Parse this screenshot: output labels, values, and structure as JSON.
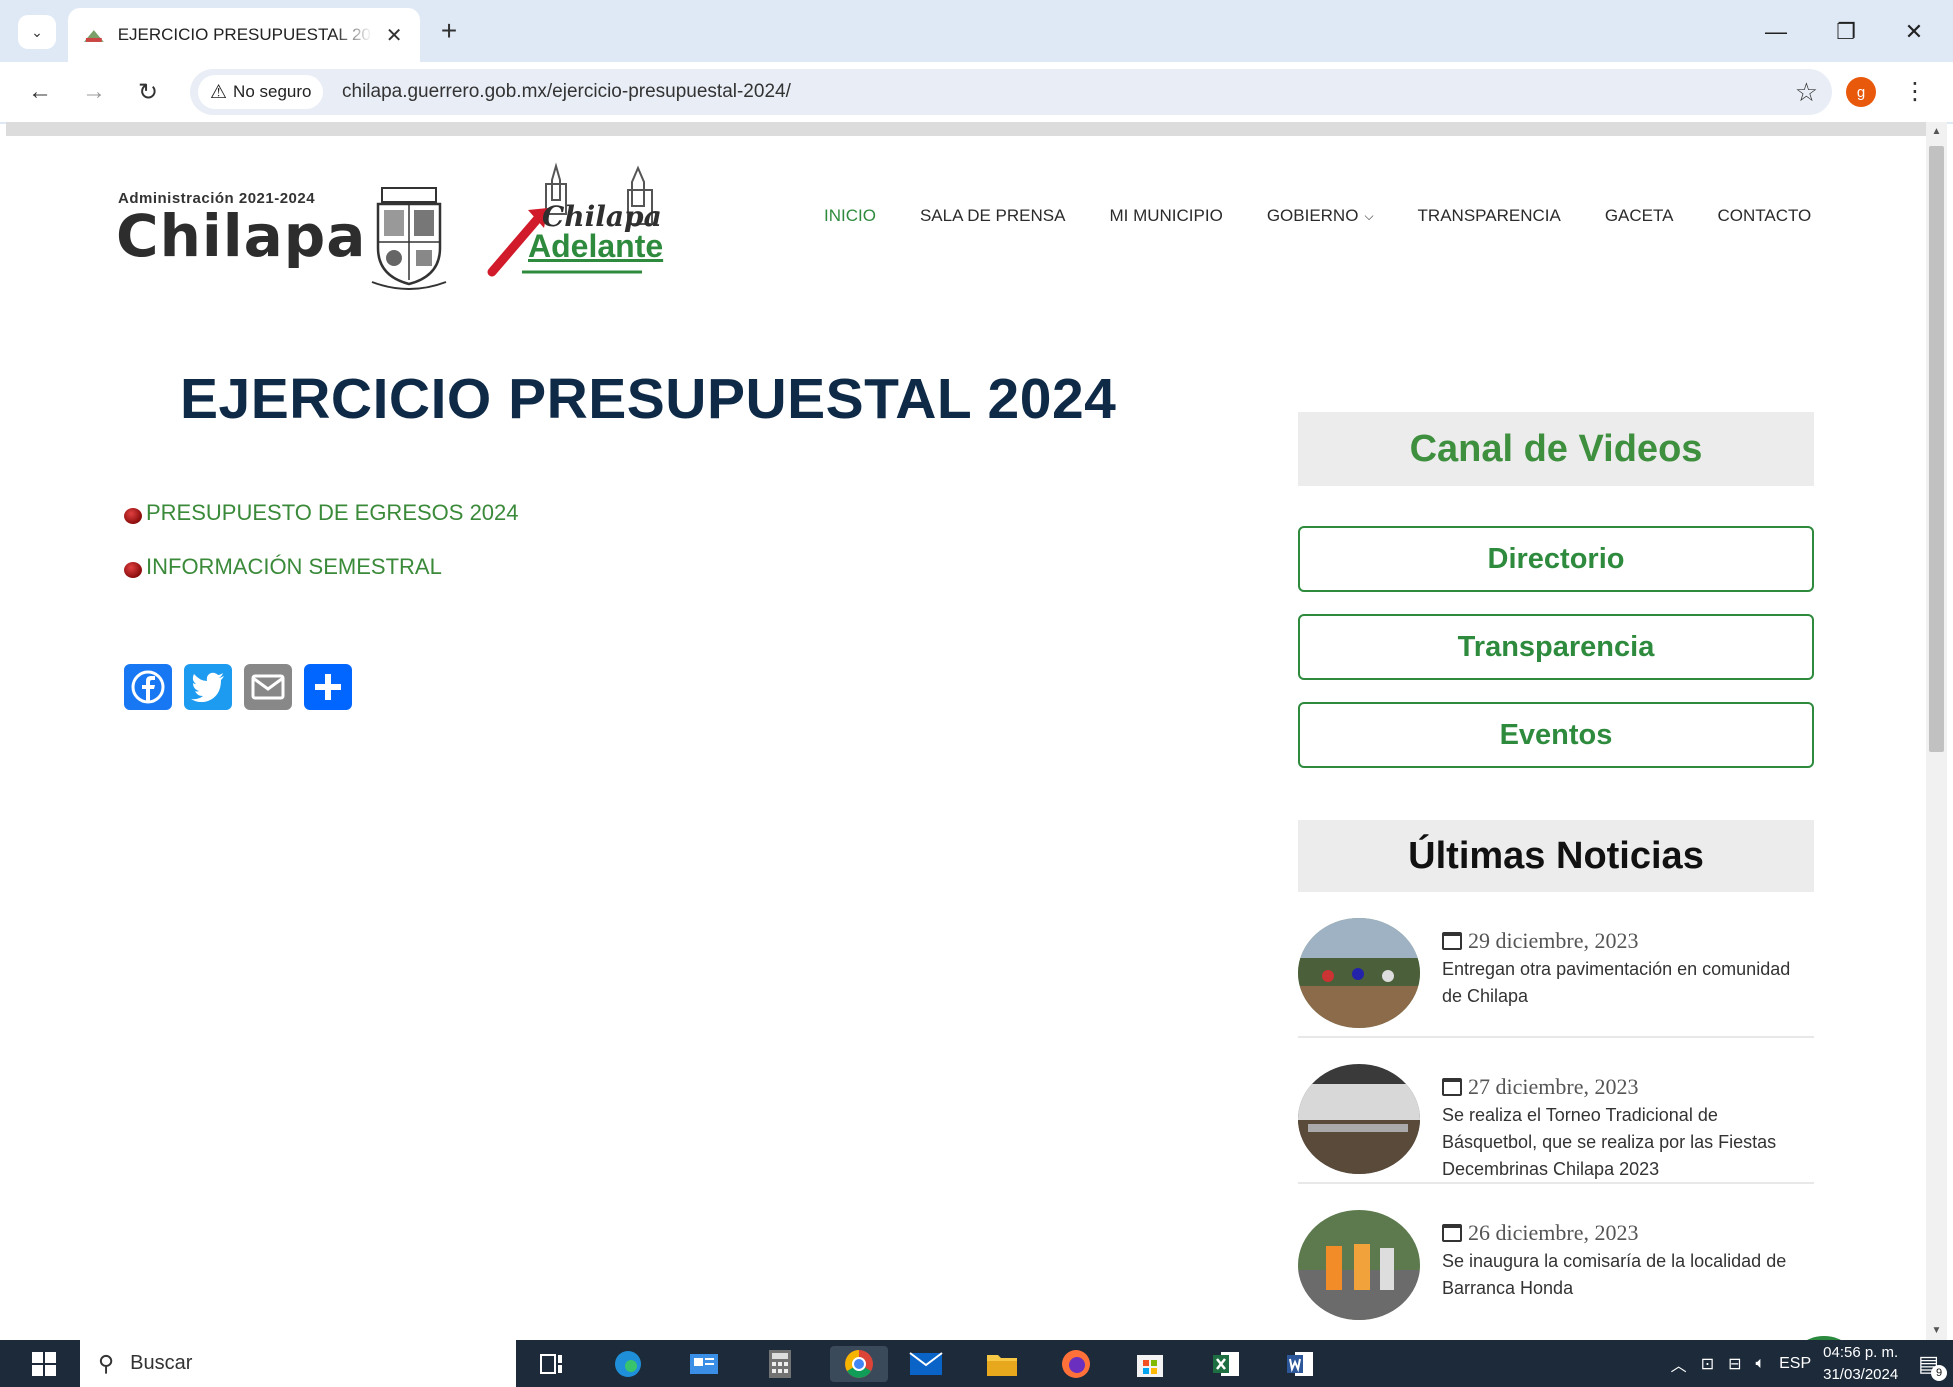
{
  "browser": {
    "tab_title": "EJERCICIO PRESUPUESTAL 2024",
    "security_label": "No seguro",
    "url": "chilapa.guerrero.gob.mx/ejercicio-presupuestal-2024/",
    "profile_initial": "g"
  },
  "site": {
    "logo_admin": "Administración 2021-2024",
    "logo_name": "Chilapa",
    "logo_script": "Chilapa",
    "logo_adelante": "Adelante",
    "nav": [
      "INICIO",
      "SALA DE PRENSA",
      "MI MUNICIPIO",
      "GOBIERNO",
      "TRANSPARENCIA",
      "GACETA",
      "CONTACTO"
    ]
  },
  "main": {
    "title": "EJERCICIO PRESUPUESTAL 2024",
    "links": [
      "PRESUPUESTO DE EGRESOS 2024",
      "INFORMACIÓN SEMESTRAL"
    ],
    "share_icons": [
      "facebook-icon",
      "twitter-icon",
      "email-icon",
      "share-plus-icon"
    ]
  },
  "sidebar": {
    "canal_videos": "Canal de Videos",
    "buttons": [
      "Directorio",
      "Transparencia",
      "Eventos"
    ],
    "ultimas_noticias": "Últimas Noticias",
    "news": [
      {
        "date": "29 diciembre, 2023",
        "text": "Entregan otra pavimentación en comunidad de Chilapa"
      },
      {
        "date": "27 diciembre, 2023",
        "text": "Se realiza el Torneo Tradicional de Básquetbol, que se realiza por las Fiestas Decembrinas Chilapa 2023"
      },
      {
        "date": "26 diciembre, 2023",
        "text": "Se inaugura la comisaría de la localidad de Barranca Honda"
      }
    ]
  },
  "taskbar": {
    "search_label": "Buscar",
    "language": "ESP",
    "time": "04:56 p. m.",
    "date": "31/03/2024",
    "notification_count": "9"
  },
  "colors": {
    "accent_green": "#2e8b3e",
    "title_navy": "#0e2a47",
    "chrome_bg": "#dfe8f5"
  }
}
